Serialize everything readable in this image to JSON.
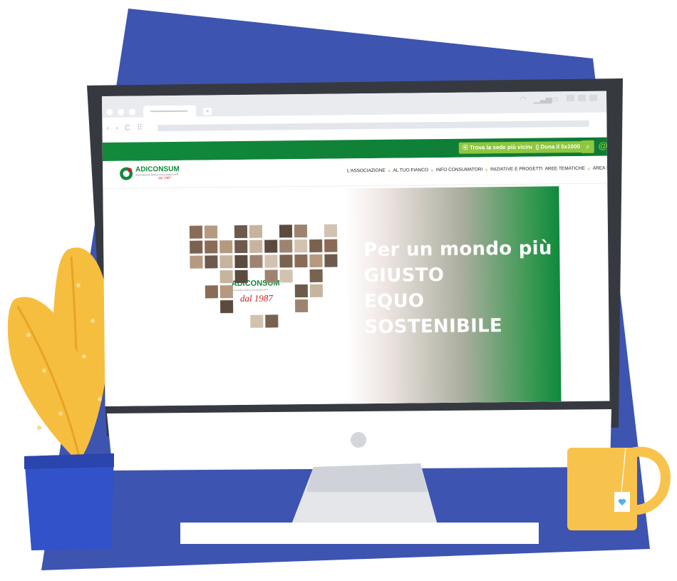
{
  "browser": {
    "status_icons": [
      "wifi-icon",
      "signal-icon",
      "battery-icon"
    ],
    "nav_icons": [
      "back-icon",
      "forward-icon",
      "reload-icon",
      "apps-icon"
    ],
    "nav_glyphs": "‹ › C ⠿",
    "new_tab_glyph": "+"
  },
  "topbar": {
    "find_office_label": "Trova la sede più vicina",
    "donate_label": "Dona il 5x1000",
    "pin_glyph": "⦿",
    "phone_glyph": "▯",
    "search_glyph": "⌕",
    "at_glyph": "@"
  },
  "logo": {
    "name": "ADICONSUM",
    "subtitle": "Associazione Difesa Consumatori APS",
    "since": "dal 1987"
  },
  "menu": {
    "items": [
      {
        "label": "L'ASSOCIAZIONE",
        "chevron": "∨"
      },
      {
        "label": "AL TUO FIANCO",
        "chevron": "∨"
      },
      {
        "label": "INFO CONSUMATORI",
        "chevron": "∨"
      },
      {
        "label": "INIZIATIVE E PROGETTI",
        "chevron": ""
      },
      {
        "label": "AREE TEMATICHE",
        "chevron": "∨"
      },
      {
        "label": "AREA STAMPA",
        "chevron": ""
      }
    ]
  },
  "hero": {
    "line1": "Per un mondo più",
    "line2": "GIUSTO",
    "line3": "EQUO",
    "line4": "SOSTENIBILE",
    "heart_logo_name": "ADICONSUM",
    "heart_logo_sub": "Associazione Difesa Consumatori APS",
    "heart_logo_since": "dal 1987"
  },
  "colors": {
    "background_shape": "#3d54b0",
    "brand_green": "#118a3c",
    "accent_green": "#8ec63f",
    "plant_yellow": "#f6be3e",
    "pot_blue": "#3d54b0",
    "mug_yellow": "#f8c34d",
    "monitor_frame": "#363a40"
  }
}
